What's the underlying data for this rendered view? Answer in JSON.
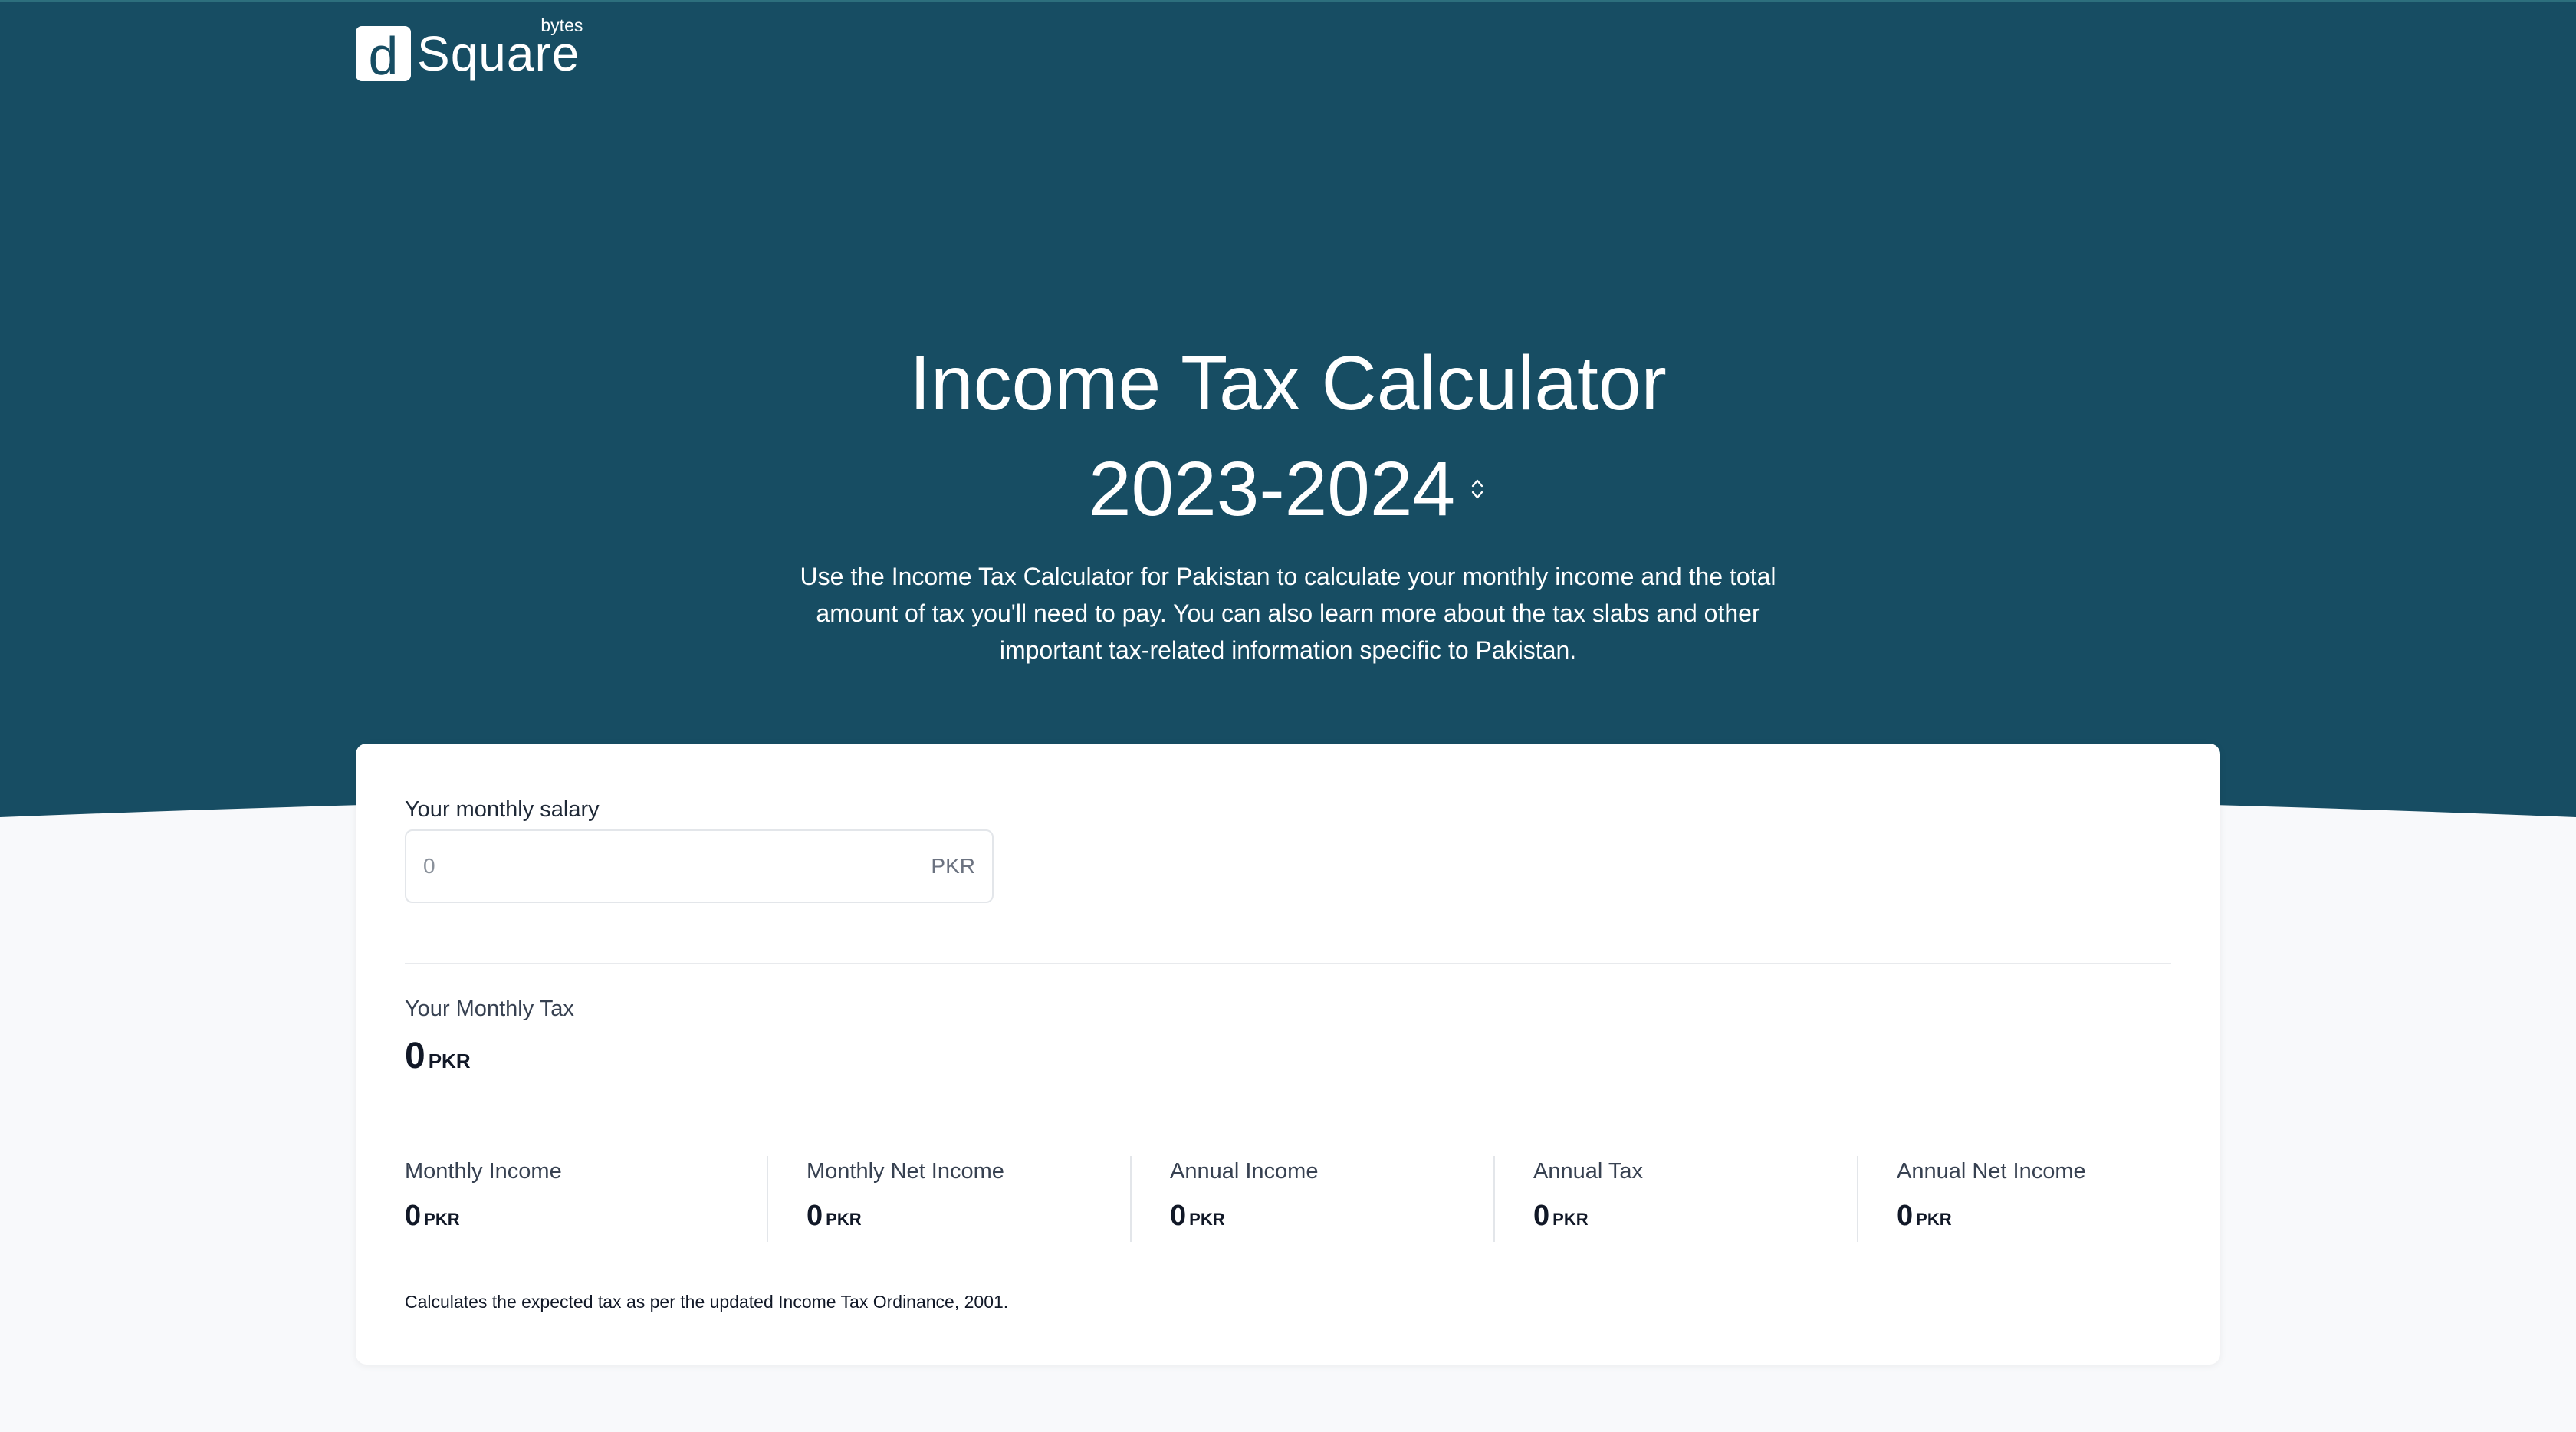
{
  "colors": {
    "hero_bg": "#174d63",
    "page_bg": "#f8f9fb",
    "card_bg": "#ffffff",
    "text_dark": "#111827",
    "text_muted": "#6b7280"
  },
  "brand": {
    "logo_letter": "d",
    "logo_word": "Square",
    "logo_superscript": "bytes"
  },
  "hero": {
    "title": "Income Tax Calculator",
    "year": "2023-2024",
    "year_selector_icon": "chevron-up-down-icon",
    "description": "Use the Income Tax Calculator for Pakistan to calculate your monthly income and the total amount of tax you'll need to pay. You can also learn more about the tax slabs and other important tax-related information specific to Pakistan."
  },
  "calculator": {
    "salary_label": "Your monthly salary",
    "salary_placeholder": "0",
    "salary_unit": "PKR",
    "monthly_tax_label": "Your Monthly Tax",
    "monthly_tax_value": "0",
    "monthly_tax_unit": "PKR",
    "stats": [
      {
        "label": "Monthly Income",
        "value": "0",
        "unit": "PKR"
      },
      {
        "label": "Monthly Net Income",
        "value": "0",
        "unit": "PKR"
      },
      {
        "label": "Annual Income",
        "value": "0",
        "unit": "PKR"
      },
      {
        "label": "Annual Tax",
        "value": "0",
        "unit": "PKR"
      },
      {
        "label": "Annual Net Income",
        "value": "0",
        "unit": "PKR"
      }
    ],
    "footnote": "Calculates the expected tax as per the updated Income Tax Ordinance, 2001."
  }
}
